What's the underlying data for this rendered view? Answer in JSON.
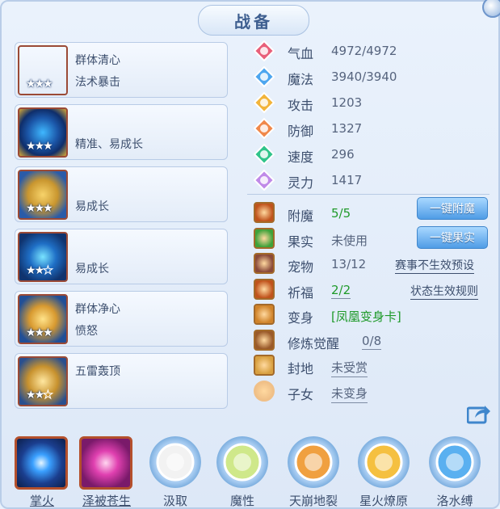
{
  "title": "战备",
  "equipment": [
    {
      "line1": "群体清心",
      "line2": "法术暴击",
      "stars": 3,
      "max_stars": 3,
      "icon": "red-sword-icon"
    },
    {
      "line1": "",
      "line2": "精准、易成长",
      "stars": 3,
      "max_stars": 3,
      "icon": "blue-gold-helmet-icon"
    },
    {
      "line1": "",
      "line2": "易成长",
      "stars": 3,
      "max_stars": 3,
      "icon": "gold-armor-icon"
    },
    {
      "line1": "",
      "line2": "易成长",
      "stars": 2,
      "max_stars": 3,
      "icon": "blue-necklace-icon"
    },
    {
      "line1": "群体净心",
      "line2": "愤怒",
      "stars": 3,
      "max_stars": 3,
      "icon": "gold-belt-icon"
    },
    {
      "line1": "五雷轰顶",
      "line2": "",
      "stars": 2,
      "max_stars": 3,
      "icon": "gold-boots-icon"
    }
  ],
  "stats": [
    {
      "label": "气血",
      "value": "4972/4972",
      "icon": "heart-icon",
      "color": "#e8607a"
    },
    {
      "label": "魔法",
      "value": "3940/3940",
      "icon": "mana-icon",
      "color": "#4da6ef"
    },
    {
      "label": "攻击",
      "value": "1203",
      "icon": "sword-icon",
      "color": "#f2b43a"
    },
    {
      "label": "防御",
      "value": "1327",
      "icon": "shield-icon",
      "color": "#f0884a"
    },
    {
      "label": "速度",
      "value": "296",
      "icon": "speed-icon",
      "color": "#30c48a"
    },
    {
      "label": "灵力",
      "value": "1417",
      "icon": "spirit-icon",
      "color": "#c08ae8"
    }
  ],
  "extras": [
    {
      "label": "附魔",
      "value": "5/5",
      "icon": "enchant-icon",
      "value_style": "green"
    },
    {
      "label": "果实",
      "value": "未使用",
      "icon": "fruit-icon",
      "value_style": "plain"
    },
    {
      "label": "宠物",
      "value": "13/12",
      "icon": "pet-icon",
      "value_style": "plain",
      "link": "赛事不生效预设"
    },
    {
      "label": "祈福",
      "value": "2/2",
      "icon": "blessing-icon",
      "value_style": "green-ul",
      "link": "状态生效规则"
    },
    {
      "label": "变身",
      "value": "[凤凰变身卡]",
      "icon": "transform-icon",
      "value_style": "green"
    },
    {
      "label": "修炼觉醒",
      "value": "0/8",
      "icon": "cultivation-icon",
      "value_style": "ul"
    },
    {
      "label": "封地",
      "value": "未受赏",
      "icon": "fief-icon",
      "value_style": "ul"
    },
    {
      "label": "子女",
      "value": "未变身",
      "icon": "child-icon",
      "value_style": "ul"
    }
  ],
  "buttons": {
    "enchant_all": "一键附魔",
    "fruit_all": "一键果实"
  },
  "skills": [
    {
      "name": "掌火",
      "icon": "palm-fire-icon",
      "style": "square-blue",
      "underline": true
    },
    {
      "name": "泽被苍生",
      "icon": "bless-hand-icon",
      "style": "square-pink",
      "underline": true
    },
    {
      "name": "汲取",
      "icon": "absorb-icon",
      "style": "ring"
    },
    {
      "name": "魔性",
      "icon": "demon-icon",
      "style": "ring"
    },
    {
      "name": "天崩地裂",
      "icon": "earthquake-icon",
      "style": "ring"
    },
    {
      "name": "星火燎原",
      "icon": "prairie-fire-icon",
      "style": "ring"
    },
    {
      "name": "洛水缚",
      "icon": "water-bind-icon",
      "style": "ring"
    }
  ]
}
